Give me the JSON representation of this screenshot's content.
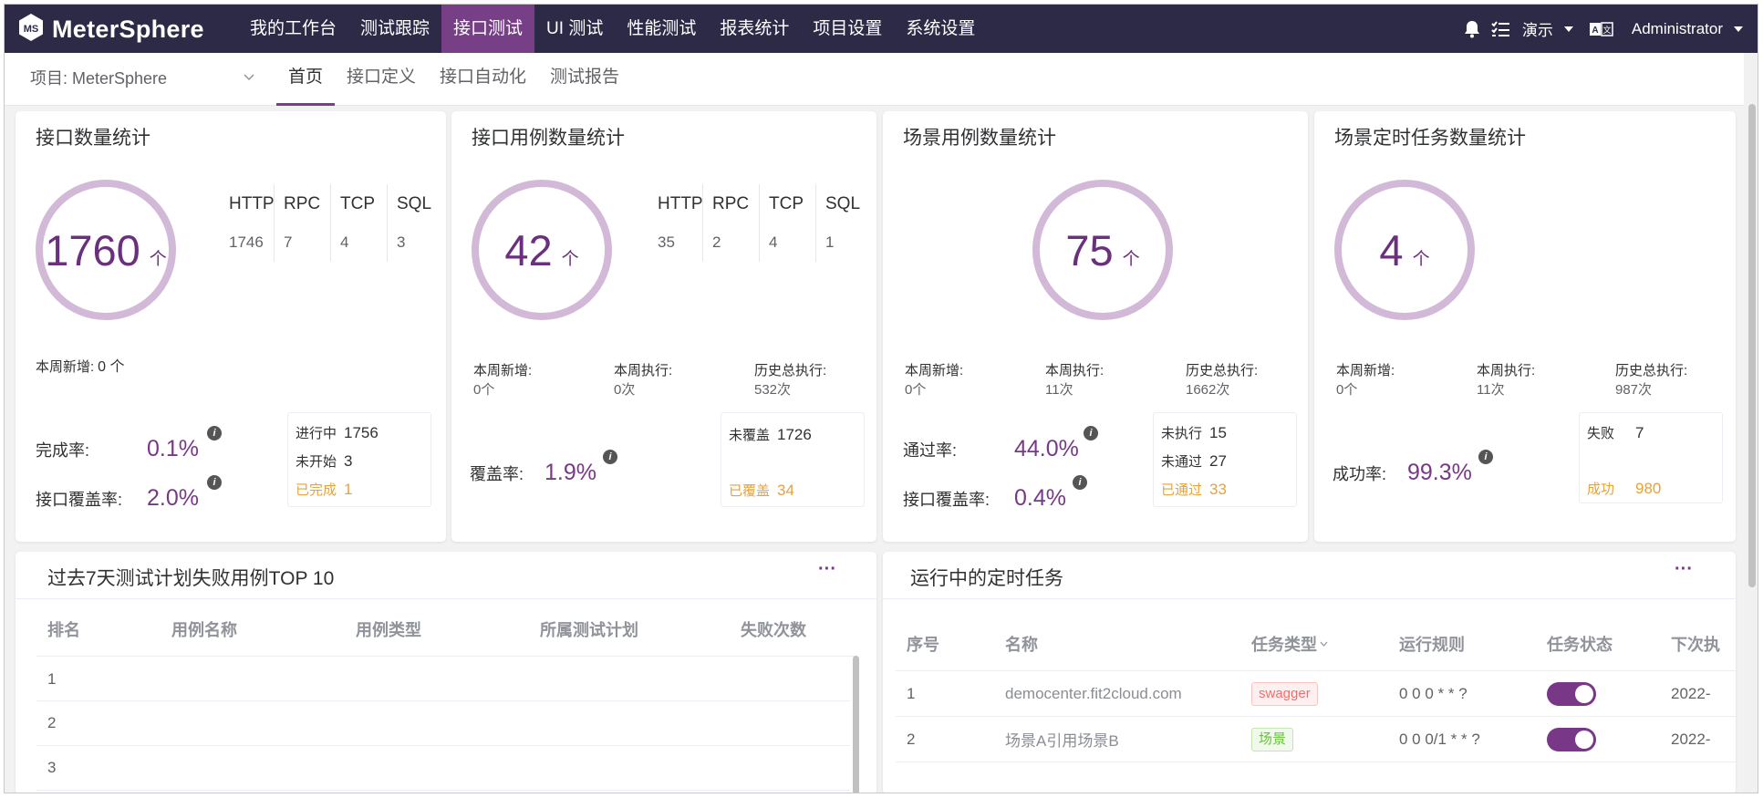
{
  "app": {
    "name": "MeterSphere"
  },
  "topnav": {
    "items": [
      "我的工作台",
      "测试跟踪",
      "接口测试",
      "UI 测试",
      "性能测试",
      "报表统计",
      "项目设置",
      "系统设置"
    ],
    "active": "接口测试"
  },
  "topright": {
    "workspace": "演示",
    "user": "Administrator"
  },
  "subnav": {
    "project": "项目: MeterSphere",
    "items": [
      "首页",
      "接口定义",
      "接口自动化",
      "测试报告"
    ],
    "active": "首页"
  },
  "cards": {
    "api": {
      "title": "接口数量统计",
      "total": "1760",
      "unit": "个",
      "protocols": [
        {
          "name": "HTTP",
          "value": "1746"
        },
        {
          "name": "RPC",
          "value": "7"
        },
        {
          "name": "TCP",
          "value": "4"
        },
        {
          "name": "SQL",
          "value": "3"
        }
      ],
      "weekly_label": "本周新增:",
      "weekly_value": "0 个",
      "completion_label": "完成率:",
      "completion_value": "0.1%",
      "coverage_label": "接口覆盖率:",
      "coverage_value": "2.0%",
      "status": [
        {
          "label": "进行中",
          "value": "1756"
        },
        {
          "label": "未开始",
          "value": "3"
        },
        {
          "label": "已完成",
          "value": "1"
        }
      ]
    },
    "case": {
      "title": "接口用例数量统计",
      "total": "42",
      "unit": "个",
      "protocols": [
        {
          "name": "HTTP",
          "value": "35"
        },
        {
          "name": "RPC",
          "value": "2"
        },
        {
          "name": "TCP",
          "value": "4"
        },
        {
          "name": "SQL",
          "value": "1"
        }
      ],
      "stats": [
        {
          "label": "本周新增:",
          "value": "0个"
        },
        {
          "label": "本周执行:",
          "value": "0次"
        },
        {
          "label": "历史总执行:",
          "value": "532次"
        }
      ],
      "coverage_label": "覆盖率:",
      "coverage_value": "1.9%",
      "status": [
        {
          "label": "未覆盖",
          "value": "1726"
        },
        {
          "label": "已覆盖",
          "value": "34"
        }
      ]
    },
    "scenario": {
      "title": "场景用例数量统计",
      "total": "75",
      "unit": "个",
      "stats": [
        {
          "label": "本周新增:",
          "value": "0个"
        },
        {
          "label": "本周执行:",
          "value": "11次"
        },
        {
          "label": "历史总执行:",
          "value": "1662次"
        }
      ],
      "pass_label": "通过率:",
      "pass_value": "44.0%",
      "coverage_label": "接口覆盖率:",
      "coverage_value": "0.4%",
      "status": [
        {
          "label": "未执行",
          "value": "15"
        },
        {
          "label": "未通过",
          "value": "27"
        },
        {
          "label": "已通过",
          "value": "33"
        }
      ]
    },
    "schedule": {
      "title": "场景定时任务数量统计",
      "total": "4",
      "unit": "个",
      "stats": [
        {
          "label": "本周新增:",
          "value": "0个"
        },
        {
          "label": "本周执行:",
          "value": "11次"
        },
        {
          "label": "历史总执行:",
          "value": "987次"
        }
      ],
      "success_label": "成功率:",
      "success_value": "99.3%",
      "status": [
        {
          "label": "失败",
          "value": "7"
        },
        {
          "label": "成功",
          "value": "980"
        }
      ]
    }
  },
  "failures": {
    "title": "过去7天测试计划失败用例TOP 10",
    "columns": [
      "排名",
      "用例名称",
      "用例类型",
      "所属测试计划",
      "失败次数"
    ],
    "rows": [
      "1",
      "2",
      "3"
    ]
  },
  "running": {
    "title": "运行中的定时任务",
    "columns": [
      "序号",
      "名称",
      "任务类型",
      "运行规则",
      "任务状态",
      "下次执"
    ],
    "rows": [
      {
        "index": "1",
        "name": "democenter.fit2cloud.com",
        "type": "swagger",
        "rule": "0 0 0 * * ?",
        "next": "2022-"
      },
      {
        "index": "2",
        "name": "场景A引用场景B",
        "type": "场景",
        "rule": "0 0 0/1 * * ?",
        "next": "2022-"
      }
    ]
  },
  "icons": [
    "metersphere-logo-icon",
    "bell-icon",
    "task-list-icon",
    "caret-down-icon",
    "translate-icon",
    "chevron-down-icon",
    "info-icon",
    "more-icon",
    "sort-caret-icon"
  ],
  "colors": {
    "topbar": "#2d2a47",
    "accent": "#783887",
    "ring": "#d3b9d8",
    "orange": "#e6a23c",
    "danger": "#f56c6c",
    "success": "#67c23a"
  }
}
